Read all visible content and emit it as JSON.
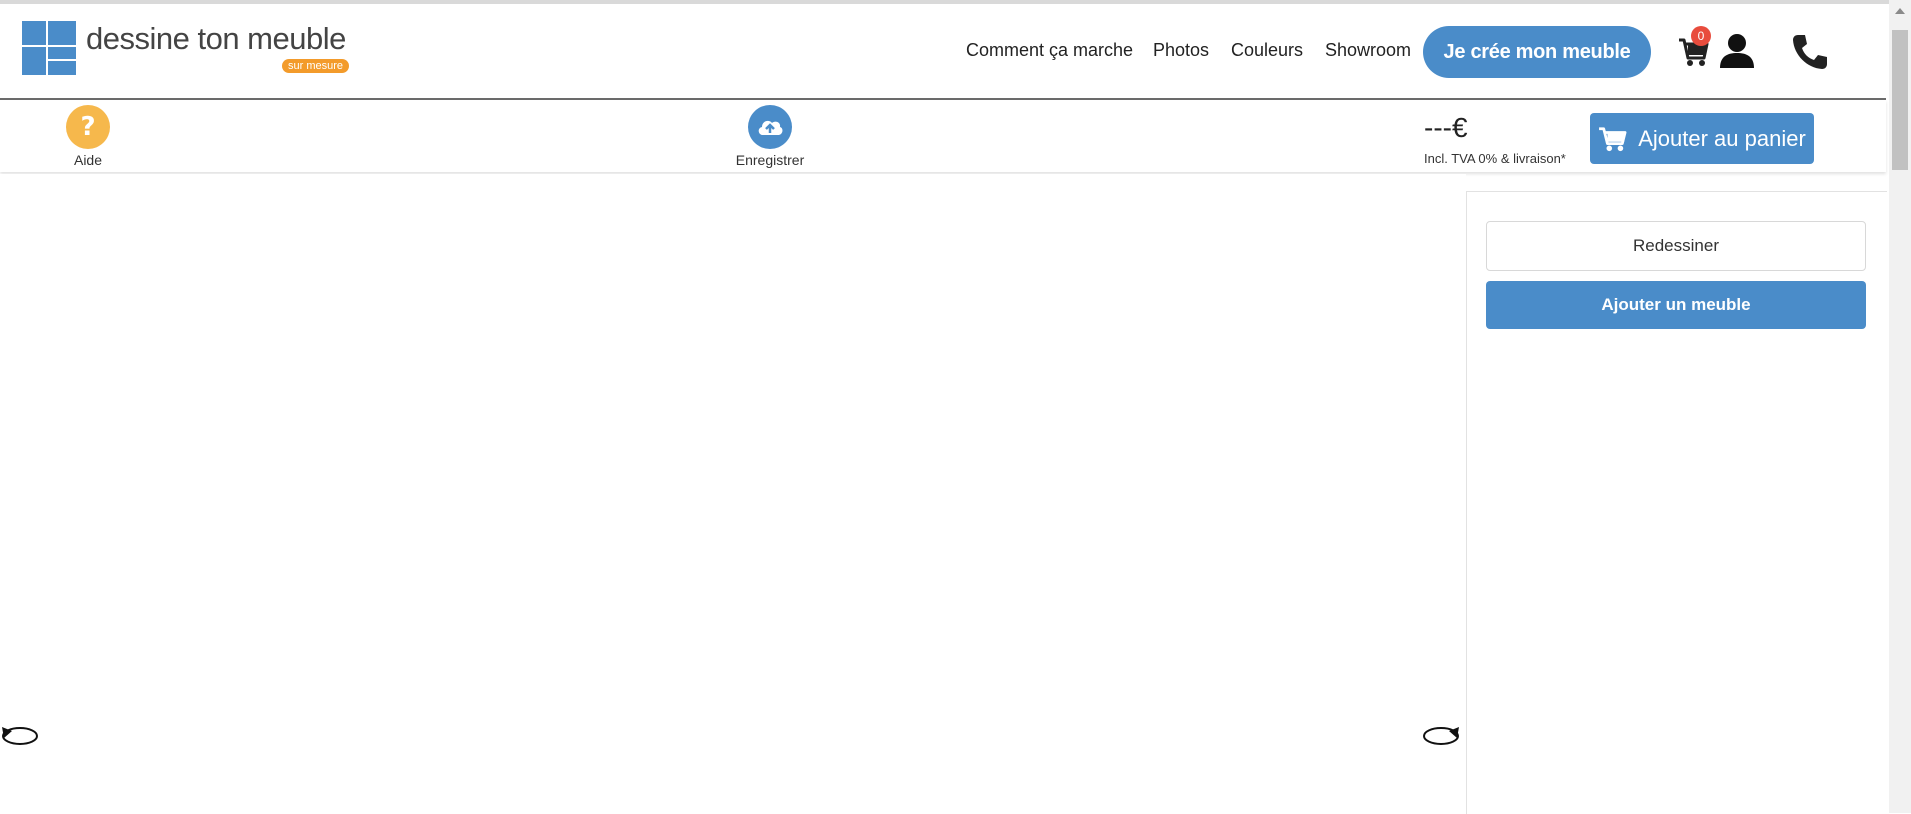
{
  "brand": {
    "name": "dessine ton meuble",
    "tagline": "sur mesure",
    "color": "#4a8cc9",
    "accent": "#f39b2b"
  },
  "nav": {
    "items": [
      "Comment ça marche",
      "Photos",
      "Couleurs",
      "Showroom"
    ],
    "cta": "Je crée mon meuble",
    "cart_count": "0"
  },
  "toolbar": {
    "help_label": "Aide",
    "save_label": "Enregistrer",
    "price": "---€",
    "price_note": "Incl. TVA 0% & livraison*",
    "add_to_cart": "Ajouter au panier"
  },
  "side_panel": {
    "redraw": "Redessiner",
    "add_furniture": "Ajouter un meuble"
  },
  "icons": {
    "help": "question-icon",
    "save": "cloud-upload-icon",
    "cart": "cart-icon",
    "user": "user-icon",
    "phone": "phone-icon",
    "rotate_left": "rotate-left-icon",
    "rotate_right": "rotate-right-icon"
  }
}
